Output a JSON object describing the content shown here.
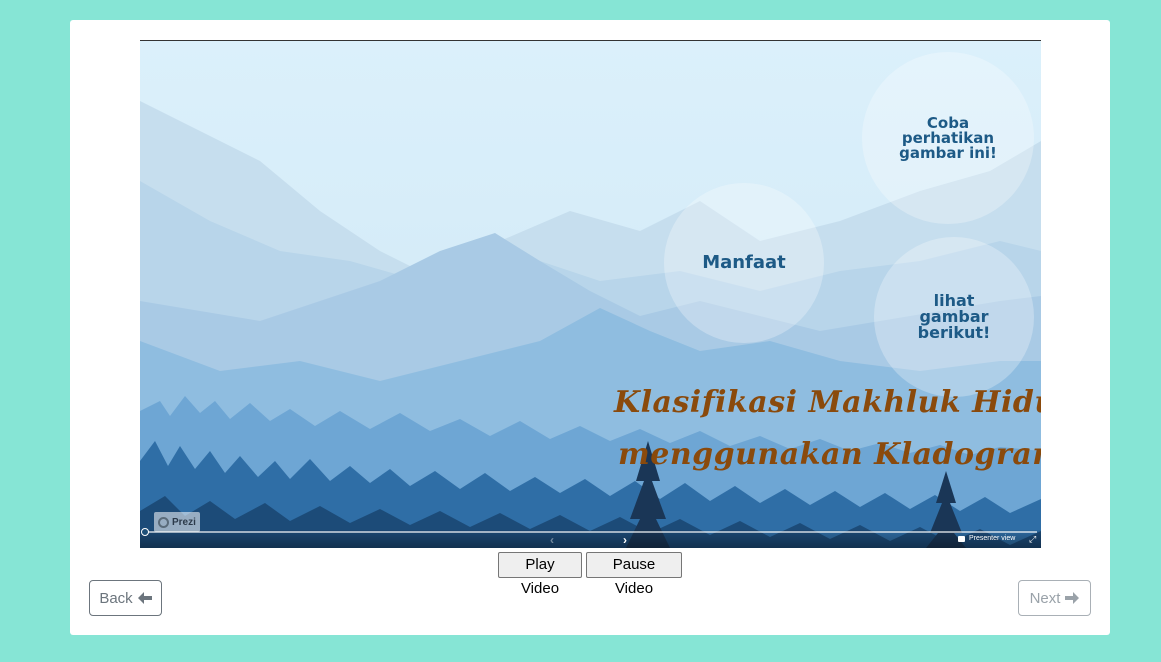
{
  "video": {
    "bubbles": {
      "b1_lines": [
        "Coba",
        "perhatikan",
        "gambar  ini!"
      ],
      "b2_label": "Manfaat",
      "b3_lines": [
        "lihat",
        "gambar",
        "berikut!"
      ]
    },
    "title_line1": "Klasifikasi Makhluk Hidup",
    "title_line2": "menggunakan Kladogram",
    "badge_label": "Prezi",
    "presenter_label": "Presenter view",
    "prev_icon": "‹",
    "next_icon": "›",
    "fullscreen_icon": "⤢",
    "progress_fraction": 0.0
  },
  "buttons": {
    "play_label": "Play Video",
    "pause_label": "Pause Video",
    "back_label": "Back",
    "next_label": "Next",
    "back_icon": "arrow-left-icon",
    "next_icon": "arrow-right-icon"
  },
  "colors": {
    "page_bg": "#86e5d5",
    "title_color": "#8a4a0c",
    "bubble_text": "#1d5a86"
  }
}
